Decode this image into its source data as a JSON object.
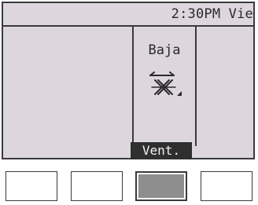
{
  "status": {
    "clock": "2:30PM Vie"
  },
  "fan": {
    "speed_label": "Baja",
    "icon": "fan-speed-louver-icon",
    "level": 1
  },
  "tabs": {
    "active_label": "Vent."
  },
  "function_buttons": [
    {
      "name": "f1",
      "pressed": false
    },
    {
      "name": "f2",
      "pressed": false
    },
    {
      "name": "f3",
      "pressed": true
    },
    {
      "name": "f4",
      "pressed": false
    }
  ],
  "colors": {
    "screen_bg": "#ddd6dc",
    "ink": "#2a2a2a",
    "pressed_button": "#8e8e8e"
  }
}
